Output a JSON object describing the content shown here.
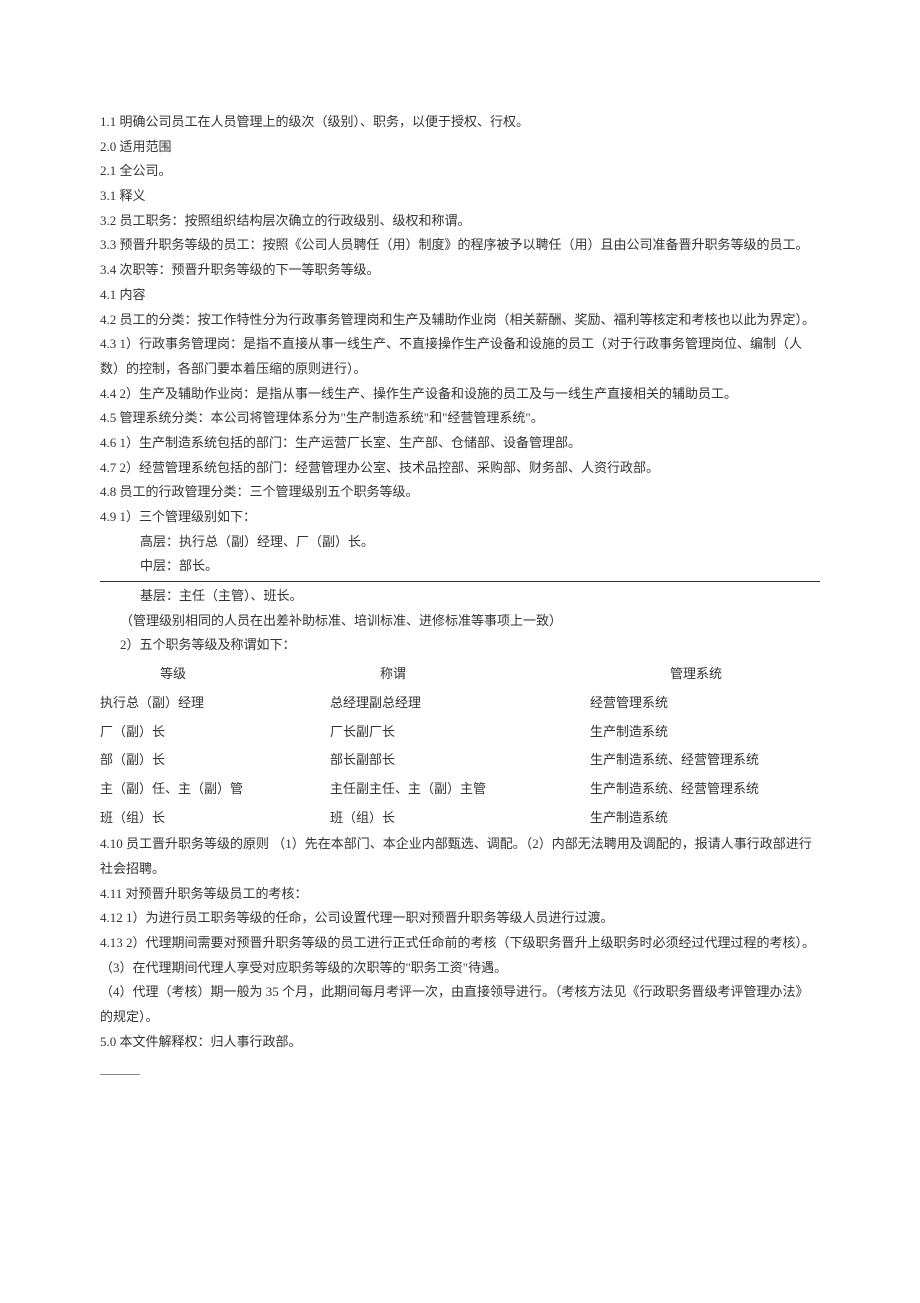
{
  "lines": {
    "l01": "1.1 明确公司员工在人员管理上的级次（级别）、职务，以便于授权、行权。",
    "l02": "2.0 适用范围",
    "l03": "2.1 全公司。",
    "l04": "3.1  释义",
    "l05": "3.2  员工职务：按照组织结构层次确立的行政级别、级权和称谓。",
    "l06": "3.3  预晋升职务等级的员工：按照《公司人员聘任（用）制度》的程序被予以聘任（用）且由公司准备晋升职务等级的员工。",
    "l07": "3.4  次职等：预晋升职务等级的下一等职务等级。",
    "l08": "4.1  内容",
    "l09": "4.2 员工的分类：按工作特性分为行政事务管理岗和生产及辅助作业岗（相关薪酬、奖励、福利等核定和考核也以此为界定）。",
    "l10": "4.3 1）行政事务管理岗：是指不直接从事一线生产、不直接操作生产设备和设施的员工（对于行政事务管理岗位、编制（人数）的控制，各部门要本着压缩的原则进行）。",
    "l11": "4.4 2）生产及辅助作业岗：是指从事一线生产、操作生产设备和设施的员工及与一线生产直接相关的辅助员工。",
    "l12": "4.5 管理系统分类：本公司将管理体系分为\"生产制造系统\"和\"经营管理系统\"。",
    "l13": "4.6 1）生产制造系统包括的部门：生产运营厂长室、生产部、仓储部、设备管理部。",
    "l14": "4.7 2）经营管理系统包括的部门：经营管理办公室、技术品控部、采购部、财务部、人资行政部。",
    "l15": "4.8 员工的行政管理分类：三个管理级别五个职务等级。",
    "l16": "4.9 1）三个管理级别如下：",
    "l17": "高层：执行总（副）经理、厂（副）长。",
    "l18": "中层：部长。",
    "l19": "基层：主任（主管）、班长。",
    "l20": "（管理级别相同的人员在出差补助标准、培训标准、进修标准等事项上一致）",
    "l21": "2）五个职务等级及称谓如下：",
    "l22": "4.10 员工晋升职务等级的原则 （1）先在本部门、本企业内部甄选、调配。（2）内部无法聘用及调配的，报请人事行政部进行社会招聘。",
    "l23": "4.11 对预晋升职务等级员工的考核：",
    "l24": "4.12 1）为进行员工职务等级的任命，公司设置代理一职对预晋升职务等级人员进行过渡。",
    "l25": "4.13 2）代理期间需要对预晋升职务等级的员工进行正式任命前的考核（下级职务晋升上级职务时必须经过代理过程的考核）。",
    "l26": "（3）在代理期间代理人享受对应职务等级的次职等的\"职务工资\"待遇。",
    "l27": "（4）代理（考核）期一般为 35 个月，此期间每月考评一次，由直接领导进行。（考核方法见《行政职务晋级考评管理办法》的规定）。",
    "l28": "5.0 本文件解释权：归人事行政部。"
  },
  "table": {
    "headers": {
      "c1": "等级",
      "c2": "称谓",
      "c3": "管理系统"
    },
    "rows": [
      {
        "c1": "执行总（副）经理",
        "c2": "总经理副总经理",
        "c3": "经营管理系统"
      },
      {
        "c1": "厂（副）长",
        "c2": "厂长副厂长",
        "c3": "生产制造系统"
      },
      {
        "c1": "部（副）长",
        "c2": "部长副部长",
        "c3": "生产制造系统、经营管理系统"
      },
      {
        "c1": "主（副）任、主（副）管",
        "c2": "主任副主任、主（副）主管",
        "c3": "生产制造系统、经营管理系统"
      },
      {
        "c1": "班（组）长",
        "c2": "班（组）长",
        "c3": "生产制造系统"
      }
    ]
  }
}
